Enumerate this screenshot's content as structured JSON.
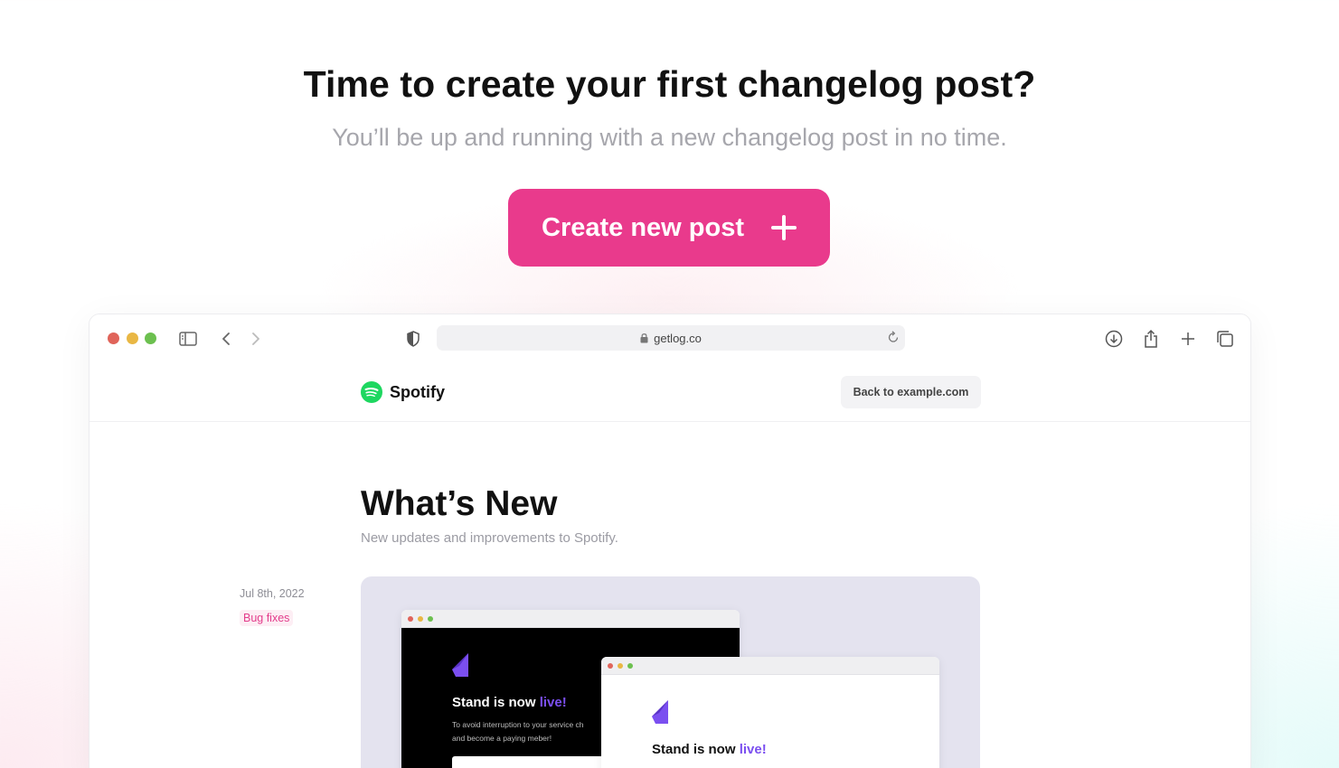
{
  "hero": {
    "title": "Time to create your first changelog post?",
    "subtitle": "You’ll be up and running with a new changelog post in no time.",
    "cta_label": "Create new post"
  },
  "browser": {
    "url": "getlog.co",
    "traffic_lights": [
      "#e0645a",
      "#e9b744",
      "#6cc04f"
    ]
  },
  "site": {
    "brand_name": "Spotify",
    "brand_color": "#1ed760",
    "back_button": "Back to example.com",
    "heading": "What’s New",
    "subheading": "New updates and improvements to Spotify."
  },
  "post": {
    "date": "Jul 8th, 2022",
    "tag": "Bug fixes",
    "preview": {
      "headline_prefix": "Stand is now ",
      "headline_accent": "live!",
      "body_line1": "To avoid interruption to your service ch",
      "body_line2": "and become a paying meber!",
      "accent_color": "#7b4ff0"
    }
  },
  "colors": {
    "cta": "#e93a8c",
    "tag": "#e33d8c"
  }
}
